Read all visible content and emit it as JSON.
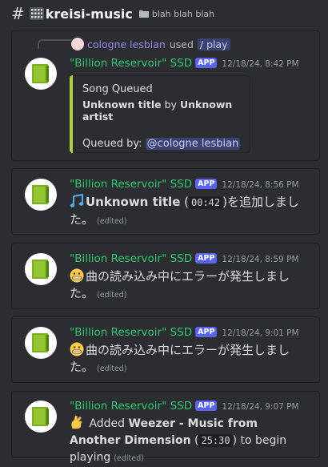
{
  "channel": {
    "hash": "#",
    "name": "kreisi-music",
    "topic": "blah blah blah"
  },
  "colors": {
    "username": "#2dc770",
    "badge": "#5865f2",
    "embed_bar": "#b0d138",
    "mention": "#c9cdfb"
  },
  "bot": {
    "name": "\"Billion Reservoir\" SSD",
    "badge": "APP"
  },
  "messages": [
    {
      "timestamp": "12/18/24, 8:42 PM",
      "reply": {
        "user": "cologne lesbian",
        "used": "used",
        "command": "/ play"
      },
      "embed": {
        "title": "Song Queued",
        "song_title": "Unknown title",
        "by": "by",
        "artist": "Unknown artist",
        "queued_by_label": "Queued by:",
        "queued_by_user": "@cologne lesbian"
      }
    },
    {
      "timestamp": "12/18/24, 8:56 PM",
      "icon": "musical-notes-icon",
      "bold": "Unknown title",
      "paren_open": " (",
      "code": "00:42",
      "text": ")を追加しました。",
      "edited": "(edited)"
    },
    {
      "timestamp": "12/18/24, 8:59 PM",
      "icon": "grimacing-face-icon",
      "text": "曲の読み込み中にエラーが発生しました。",
      "edited": "(edited)"
    },
    {
      "timestamp": "12/18/24, 9:01 PM",
      "icon": "grimacing-face-icon",
      "text": "曲の読み込み中にエラーが発生しました。",
      "edited": "(edited)"
    },
    {
      "timestamp": "12/18/24, 9:07 PM",
      "icon": "crossed-fingers-icon",
      "prefix": " Added ",
      "bold": "Weezer - Music from Another Dimension",
      "paren_open": " (",
      "code": "25:30",
      "suffix": ") to begin playing",
      "edited": "(edited)"
    }
  ]
}
